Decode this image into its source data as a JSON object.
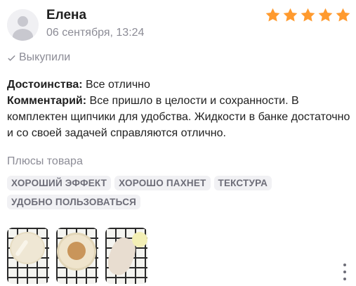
{
  "review": {
    "author": "Елена",
    "date": "06 сентября, 13:24",
    "rating": 5,
    "bought_label": "Выкупили",
    "advantages_label": "Достоинства:",
    "advantages_text": "Все отлично",
    "comment_label": "Комментарий:",
    "comment_text": "Все пришло в целости и сохранности. В комплектен щипчики для удобства. Жидкости в банке достаточно и со своей задачей справляются отлично.",
    "plus_title": "Плюсы товара",
    "tags": [
      "ХОРОШИЙ ЭФФЕКТ",
      "ХОРОШО ПАХНЕТ",
      "ТЕКСТУРА",
      "УДОБНО ПОЛЬЗОВАТЬСЯ"
    ],
    "photos": [
      "photo-jar-closed",
      "photo-jar-open",
      "photo-pads"
    ]
  },
  "colors": {
    "star": "#ff9a2e",
    "muted_text": "#8c8c96",
    "tag_bg": "#f1f1f4"
  },
  "icons": {
    "check": "check-icon",
    "more": "more-vertical-icon"
  }
}
